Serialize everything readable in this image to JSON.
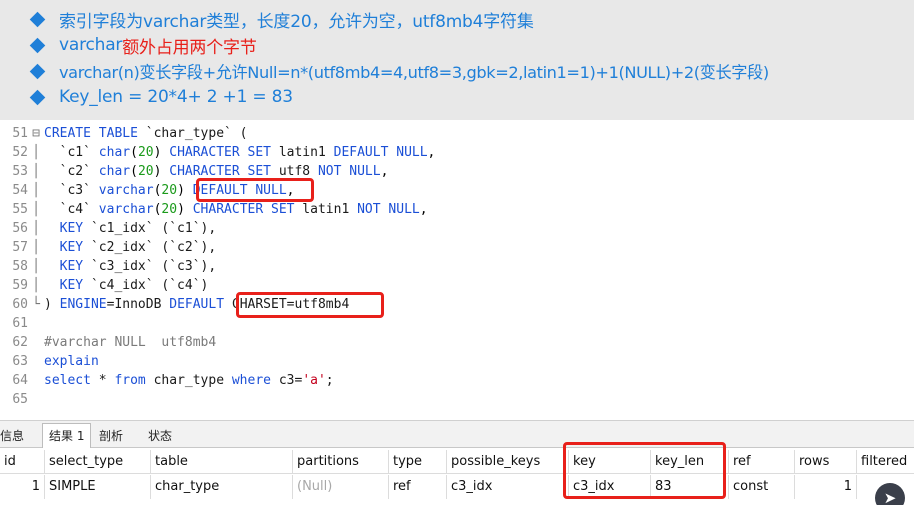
{
  "bullets": [
    "索引字段为varchar类型，长度20，允许为空，utf8mb4字符集",
    "varchar",
    "额外占用两个字节",
    "varchar(n)变长字段+允许Null=n*(utf8mb4=4,utf8=3,gbk=2,latin1=1)+1(NULL)+2(变长字段)",
    "Key_len = 20*4+ 2 +1 = 83"
  ],
  "editor": {
    "line_numbers": [
      "51",
      "52",
      "53",
      "54",
      "55",
      "56",
      "57",
      "58",
      "59",
      "60",
      "61",
      "62",
      "63",
      "64",
      "65"
    ],
    "code": {
      "l51_kw": "CREATE TABLE",
      "l51_rest": " `char_type` (",
      "l52_name": "  `c1` ",
      "l52_type": "char",
      "l52_num": "20",
      "l52_kw1": "CHARACTER SET",
      "l52_cs": " latin1 ",
      "l52_kw2": "DEFAULT NULL",
      "l53_name": "  `c2` ",
      "l53_type": "char",
      "l53_num": "20",
      "l53_kw1": "CHARACTER SET",
      "l53_cs": " utf8 ",
      "l53_kw2": "NOT NULL",
      "l54_name": "  `c3` ",
      "l54_type": "varchar",
      "l54_num": "20",
      "l54_kw": "DEFAULT NULL",
      "l55_name": "  `c4` ",
      "l55_type": "varchar",
      "l55_num": "20",
      "l55_kw1": "CHARACTER SET",
      "l55_cs": " latin1 ",
      "l55_kw2": "NOT NULL",
      "l56_kw": "  KEY",
      "l56_rest": " `c1_idx` (`c1`),",
      "l57_kw": "  KEY",
      "l57_rest": " `c2_idx` (`c2`),",
      "l58_kw": "  KEY",
      "l58_rest": " `c3_idx` (`c3`),",
      "l59_kw": "  KEY",
      "l59_rest": " `c4_idx` (`c4`)",
      "l60_a": ") ",
      "l60_kw1": "ENGINE",
      "l60_b": "=InnoDB ",
      "l60_kw2": "DEFAULT",
      "l60_c": " CHARSET=utf8mb4",
      "l62_cmt": "#varchar NULL  utf8mb4",
      "l63_kw": "explain",
      "l64_kw1": "select",
      "l64_a": " * ",
      "l64_kw2": "from",
      "l64_b": " char_type ",
      "l64_kw3": "where",
      "l64_c": " c3=",
      "l64_str": "'a'",
      "l64_d": ";"
    }
  },
  "result_tabs": [
    "信息",
    "结果 1",
    "剖析",
    "状态"
  ],
  "table": {
    "headers": [
      "id",
      "select_type",
      "table",
      "partitions",
      "type",
      "possible_keys",
      "key",
      "key_len",
      "ref",
      "rows",
      "filtered"
    ],
    "row": [
      "1",
      "SIMPLE",
      "char_type",
      "(Null)",
      "ref",
      "c3_idx",
      "c3_idx",
      "83",
      "const",
      "1",
      ""
    ]
  },
  "colors": {
    "accent": "#1f7fd8",
    "highlight": "#e8201a",
    "keyword": "#1b4fd6",
    "number": "#1a9a1a",
    "string": "#c4001d"
  },
  "icons": {
    "fab": "navigation-arrow-icon"
  }
}
